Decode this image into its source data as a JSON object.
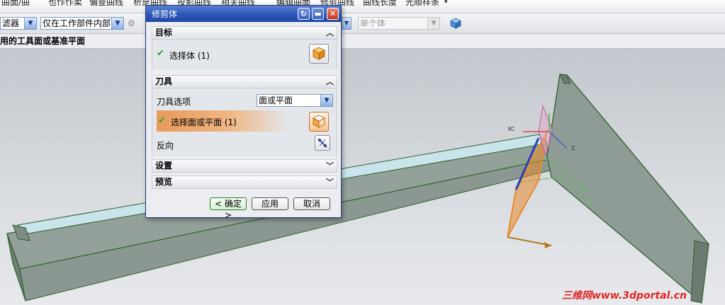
{
  "menubar": {
    "items": [
      "曲面/曲",
      "也作作柔",
      "偏查曲线",
      "析是曲线",
      "投影曲线",
      "相关曲线",
      "编辑曲面",
      "修剪曲线",
      "曲线长度",
      "光顺样条"
    ]
  },
  "toolbar": {
    "filter_label": "滤器",
    "scope_value": "仅在工作部件内部",
    "body_value": "单个体"
  },
  "cue_line": "用的工具面或基准平面",
  "dialog": {
    "title": "修剪体",
    "sections": {
      "target": {
        "header": "目标",
        "select_label": "选择体 (1)"
      },
      "tool": {
        "header": "刀具",
        "tool_option_label": "刀具选项",
        "tool_option_value": "面或平面",
        "select_label": "选择面或平面 (1)",
        "reverse_label": "反向"
      },
      "settings": {
        "header": "设置"
      },
      "preview": {
        "header": "预览"
      }
    },
    "buttons": {
      "ok": "< 确定 >",
      "apply": "应用",
      "cancel": "取消"
    }
  },
  "viewport": {
    "triad_labels": {
      "x": "XC",
      "z": "Z"
    }
  },
  "watermark": "三维网www.3dportal.cn",
  "colors": {
    "title_bar": "#2a55b8",
    "check": "#2aa431",
    "active_row": "#f0a566",
    "panel_surface": "#c9e4ea",
    "part_edge": "#2f5f2f",
    "plane_orange": "#e88a2e",
    "watermark": "#e02626"
  }
}
